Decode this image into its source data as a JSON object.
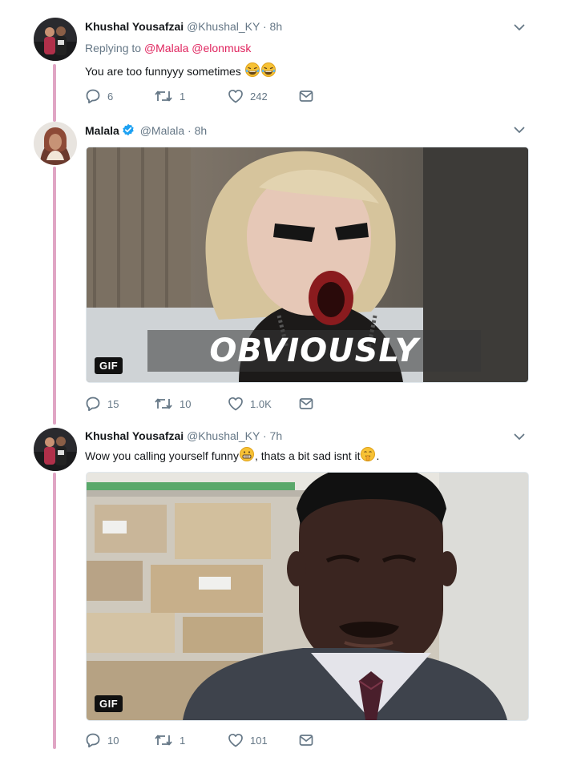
{
  "tweets": [
    {
      "name": "Khushal Yousafzai",
      "handle": "@Khushal_KY",
      "dot": "·",
      "time": "8h",
      "replying_prefix": "Replying to",
      "replying_mentions": [
        "@Malala",
        "@elonmusk"
      ],
      "text": "You are too funnyyy sometimes",
      "text_emoji": [
        "joy-emoji",
        "joy-emoji"
      ],
      "replies": "6",
      "retweets": "1",
      "likes": "242"
    },
    {
      "name": "Malala",
      "verified": true,
      "handle": "@Malala",
      "dot": "·",
      "time": "8h",
      "gif_caption": "OBVIOUSLY",
      "gif_badge": "GIF",
      "replies": "15",
      "retweets": "10",
      "likes": "1.0K"
    },
    {
      "name": "Khushal Yousafzai",
      "handle": "@Khushal_KY",
      "dot": "·",
      "time": "7h",
      "text_part1": "Wow you calling yourself funny",
      "text_part2": ", thats a bit sad isnt it",
      "text_end": ".",
      "gif_badge": "GIF",
      "replies": "10",
      "retweets": "1",
      "likes": "101"
    }
  ],
  "colors": {
    "accent_mention": "#e0245e",
    "thread_line": "#e0a5c4",
    "verified": "#1da1f2",
    "muted": "#657786"
  },
  "icons": [
    "reply-icon",
    "retweet-icon",
    "like-icon",
    "dm-icon",
    "chevron-down-icon",
    "verified-badge-icon"
  ]
}
